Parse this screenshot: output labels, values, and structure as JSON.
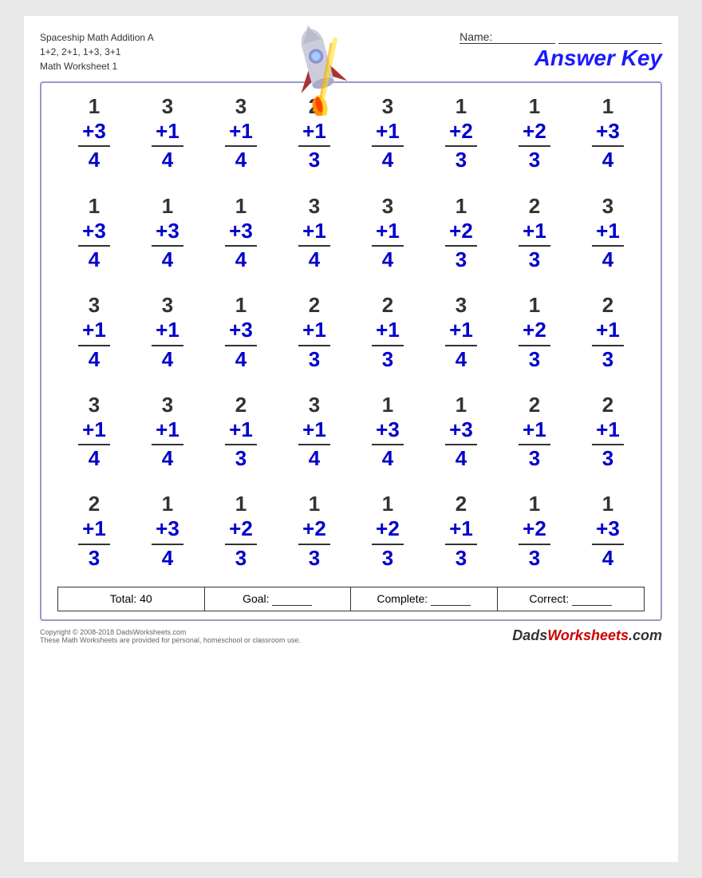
{
  "header": {
    "title_line1": "Spaceship Math Addition A",
    "title_line2": "1+2, 2+1, 1+3, 3+1",
    "title_line3": "Math Worksheet 1",
    "name_label": "Name:",
    "answer_key_label": "Answer Key"
  },
  "problems": [
    [
      {
        "top": "1",
        "addend": "+3",
        "answer": "4"
      },
      {
        "top": "3",
        "addend": "+1",
        "answer": "4"
      },
      {
        "top": "3",
        "addend": "+1",
        "answer": "4"
      },
      {
        "top": "2",
        "addend": "+1",
        "answer": "3"
      },
      {
        "top": "3",
        "addend": "+1",
        "answer": "4"
      },
      {
        "top": "1",
        "addend": "+2",
        "answer": "3"
      },
      {
        "top": "1",
        "addend": "+2",
        "answer": "3"
      },
      {
        "top": "1",
        "addend": "+3",
        "answer": "4"
      }
    ],
    [
      {
        "top": "1",
        "addend": "+3",
        "answer": "4"
      },
      {
        "top": "1",
        "addend": "+3",
        "answer": "4"
      },
      {
        "top": "1",
        "addend": "+3",
        "answer": "4"
      },
      {
        "top": "3",
        "addend": "+1",
        "answer": "4"
      },
      {
        "top": "3",
        "addend": "+1",
        "answer": "4"
      },
      {
        "top": "1",
        "addend": "+2",
        "answer": "3"
      },
      {
        "top": "2",
        "addend": "+1",
        "answer": "3"
      },
      {
        "top": "3",
        "addend": "+1",
        "answer": "4"
      }
    ],
    [
      {
        "top": "3",
        "addend": "+1",
        "answer": "4"
      },
      {
        "top": "3",
        "addend": "+1",
        "answer": "4"
      },
      {
        "top": "1",
        "addend": "+3",
        "answer": "4"
      },
      {
        "top": "2",
        "addend": "+1",
        "answer": "3"
      },
      {
        "top": "2",
        "addend": "+1",
        "answer": "3"
      },
      {
        "top": "3",
        "addend": "+1",
        "answer": "4"
      },
      {
        "top": "1",
        "addend": "+2",
        "answer": "3"
      },
      {
        "top": "2",
        "addend": "+1",
        "answer": "3"
      }
    ],
    [
      {
        "top": "3",
        "addend": "+1",
        "answer": "4"
      },
      {
        "top": "3",
        "addend": "+1",
        "answer": "4"
      },
      {
        "top": "2",
        "addend": "+1",
        "answer": "3"
      },
      {
        "top": "3",
        "addend": "+1",
        "answer": "4"
      },
      {
        "top": "1",
        "addend": "+3",
        "answer": "4"
      },
      {
        "top": "1",
        "addend": "+3",
        "answer": "4"
      },
      {
        "top": "2",
        "addend": "+1",
        "answer": "3"
      },
      {
        "top": "2",
        "addend": "+1",
        "answer": "3"
      }
    ],
    [
      {
        "top": "2",
        "addend": "+1",
        "answer": "3"
      },
      {
        "top": "1",
        "addend": "+3",
        "answer": "4"
      },
      {
        "top": "1",
        "addend": "+2",
        "answer": "3"
      },
      {
        "top": "1",
        "addend": "+2",
        "answer": "3"
      },
      {
        "top": "1",
        "addend": "+2",
        "answer": "3"
      },
      {
        "top": "2",
        "addend": "+1",
        "answer": "3"
      },
      {
        "top": "1",
        "addend": "+2",
        "answer": "3"
      },
      {
        "top": "1",
        "addend": "+3",
        "answer": "4"
      }
    ]
  ],
  "footer": {
    "total_label": "Total:",
    "total_value": "40",
    "goal_label": "Goal:",
    "complete_label": "Complete:",
    "correct_label": "Correct:"
  },
  "copyright": {
    "line1": "Copyright © 2008-2018 DadsWorksheets.com",
    "line2": "These Math Worksheets are provided for personal, homeschool or classroom use.",
    "logo": "DadsWorksheets.com"
  }
}
